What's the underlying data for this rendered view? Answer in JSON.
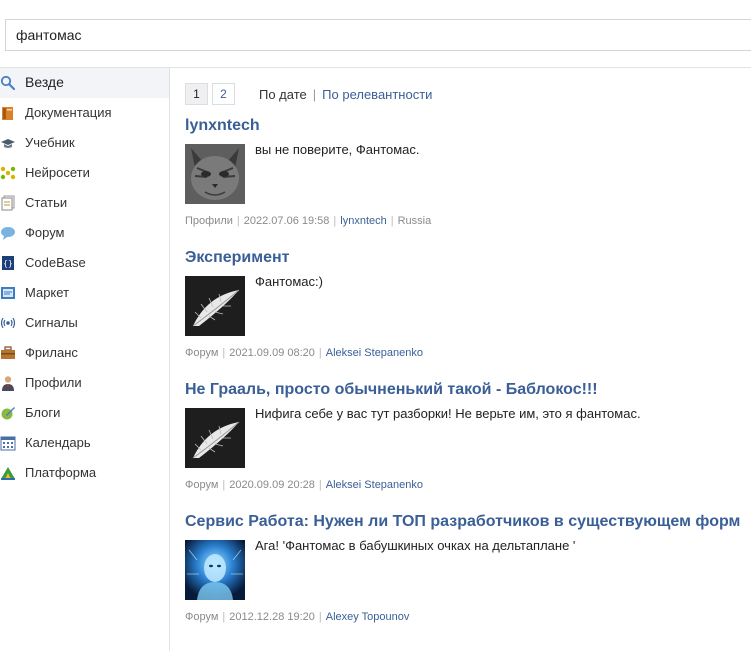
{
  "search": {
    "value": "фантомас"
  },
  "sidebar": {
    "items": [
      {
        "label": "Везде",
        "icon": "search-icon"
      },
      {
        "label": "Документация",
        "icon": "book-icon"
      },
      {
        "label": "Учебник",
        "icon": "graduation-cap-icon"
      },
      {
        "label": "Нейросети",
        "icon": "neural-network-icon"
      },
      {
        "label": "Статьи",
        "icon": "articles-icon"
      },
      {
        "label": "Форум",
        "icon": "speech-bubble-icon"
      },
      {
        "label": "CodeBase",
        "icon": "codebase-icon"
      },
      {
        "label": "Маркет",
        "icon": "market-icon"
      },
      {
        "label": "Сигналы",
        "icon": "signal-icon"
      },
      {
        "label": "Фриланс",
        "icon": "briefcase-icon"
      },
      {
        "label": "Профили",
        "icon": "person-icon"
      },
      {
        "label": "Блоги",
        "icon": "blog-icon"
      },
      {
        "label": "Календарь",
        "icon": "calendar-icon"
      },
      {
        "label": "Платформа",
        "icon": "platform-icon"
      }
    ]
  },
  "pagination": {
    "pages": [
      "1",
      "2"
    ],
    "sort_by_date": "По дате",
    "separator": "|",
    "sort_by_relevance": "По релевантности"
  },
  "results": [
    {
      "title": "lynxntech",
      "snippet": "вы не поверите, Фантомас.",
      "section": "Профили",
      "date": "2022.07.06 19:58",
      "author": "lynxntech",
      "country": "Russia",
      "thumb": "cat-avatar"
    },
    {
      "title": "Эксперимент",
      "snippet": "Фантомас:)",
      "section": "Форум",
      "date": "2021.09.09 08:20",
      "author": "Aleksei Stepanenko",
      "thumb": "feather-avatar"
    },
    {
      "title": "Не Грааль, просто обычненький такой - Баблокос!!!",
      "snippet": "Нифига себе у вас тут разборки! Не верьте им, это я фантомас.",
      "section": "Форум",
      "date": "2020.09.09 20:28",
      "author": "Aleksei Stepanenko",
      "thumb": "feather-avatar"
    },
    {
      "title": "Сервис Работа: Нужен ли ТОП разработчиков в существующем форм",
      "snippet": "Ага! 'Фантомас в бабушкиных очках на дельтаплане '",
      "section": "Форум",
      "date": "2012.12.28 19:20",
      "author": "Alexey Topounov",
      "thumb": "digital-head-avatar"
    }
  ],
  "colors": {
    "link": "#3a5f96",
    "meta": "#8a8a8a",
    "active_bg": "#f2f4f8",
    "border": "#e2e2e2"
  }
}
